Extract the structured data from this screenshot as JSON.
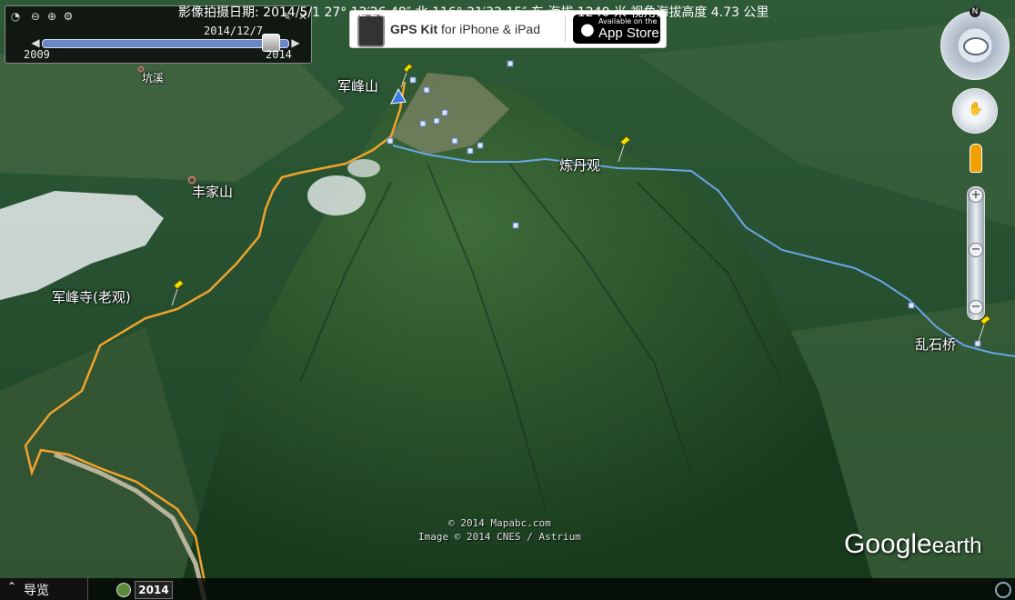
{
  "map": {
    "labels": {
      "junfengshan": "军峰山",
      "liandanguan": "炼丹观",
      "fengjiashan": "丰家山",
      "junfengsi": "军峰寺(老观)",
      "luanshiqiao": "乱石桥",
      "kangxi": "坑溪"
    },
    "track_colors": {
      "orange": "#f0a22c",
      "blue": "#6aa6e6"
    }
  },
  "time_panel": {
    "date": "2014/12/7",
    "start_year": "2009",
    "end_year": "2014"
  },
  "ad": {
    "title_bold": "GPS Kit",
    "title_rest": "for iPhone & iPad",
    "store_small": "Available on the",
    "store_big": "App Store"
  },
  "nav": {
    "north_label": "N",
    "zoom_in": "+",
    "zoom_out": "−"
  },
  "copyright": {
    "line1": "© 2014 Mapabc.com",
    "line2": "Image © 2014 CNES / Astrium"
  },
  "logo": {
    "google": "Google",
    "earth": "earth"
  },
  "status": {
    "nav_label": "导览",
    "year_badge": "2014",
    "text": "影像拍摄日期: 2014/5/1   27° 12′26.48″ 北 116° 21′32.15″ 东 海拔  1240 米   视角海拔高度   4.73 公里"
  }
}
